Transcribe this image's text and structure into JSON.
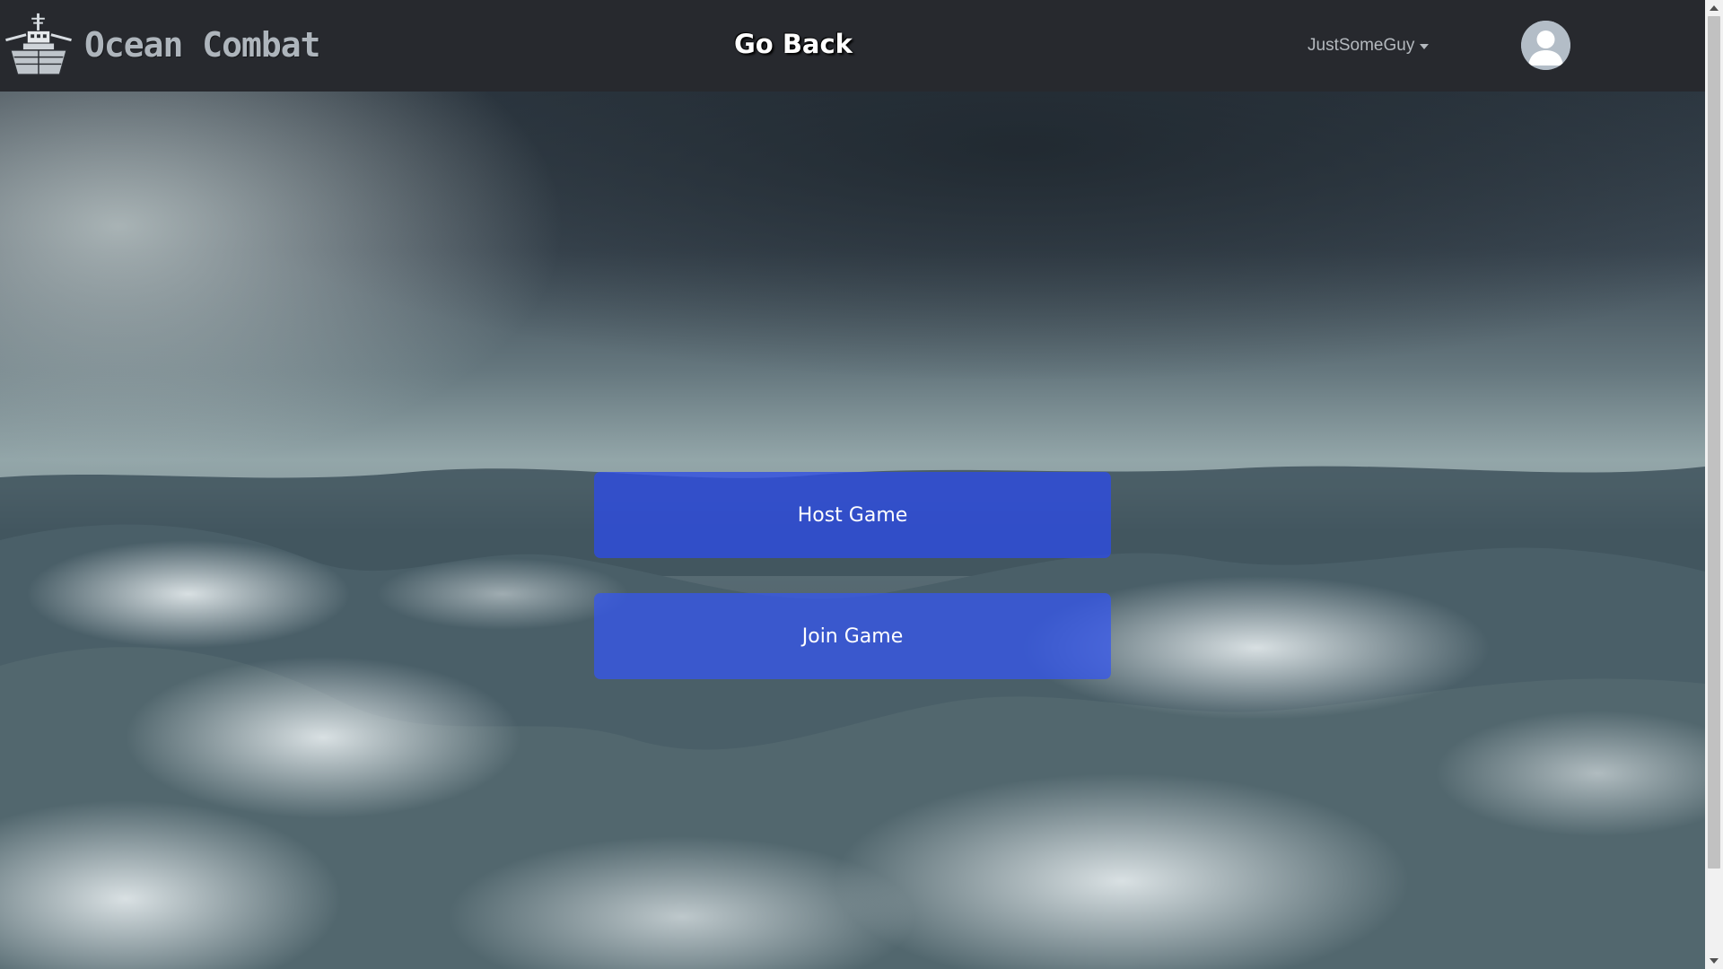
{
  "header": {
    "brand": {
      "word1": "Ocean",
      "word2": "Combat",
      "logo_icon": "battleship-icon"
    },
    "go_back_label": "Go Back",
    "user": {
      "name": "JustSomeGuy",
      "avatar_icon": "user-silhouette-icon",
      "menu_icon": "caret-down-icon"
    }
  },
  "main": {
    "background": "stormy-ocean-waves",
    "buttons": {
      "host_label": "Host Game",
      "join_label": "Join Game"
    }
  },
  "colors": {
    "navbar_bg": "#27292e",
    "button_bg": "#2d4ce6",
    "button_text": "#ffffff",
    "brand_text": "#aeb5bc",
    "user_text": "#b4b9be"
  }
}
